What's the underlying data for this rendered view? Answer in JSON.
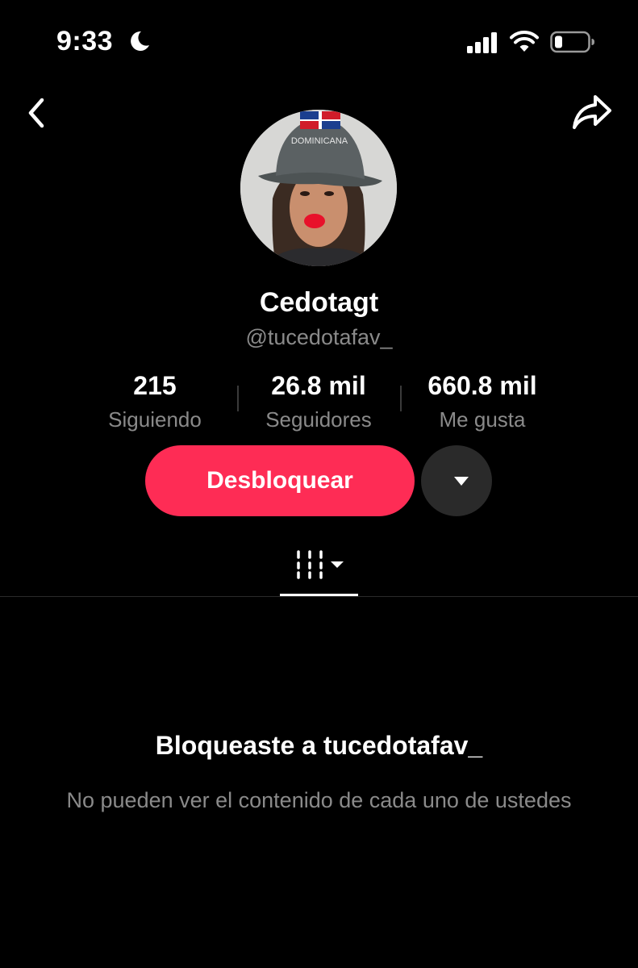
{
  "status_bar": {
    "time": "9:33",
    "icons": [
      "moon-icon",
      "signal-icon",
      "wifi-icon",
      "battery-icon"
    ]
  },
  "nav": {
    "icons": [
      "back-icon",
      "share-icon"
    ]
  },
  "profile": {
    "display_name": "Cedotagt",
    "username": "@tucedotafav_",
    "avatar_hat_text": "DOMINICANA"
  },
  "stats": [
    {
      "value": "215",
      "label": "Siguiendo"
    },
    {
      "value": "26.8 mil",
      "label": "Seguidores"
    },
    {
      "value": "660.8 mil",
      "label": "Me gusta"
    }
  ],
  "actions": {
    "unblock_label": "Desbloquear"
  },
  "tabs": {
    "icon": "grid-icon"
  },
  "blocked": {
    "title": "Bloqueaste a tucedotafav_",
    "description": "No pueden ver el contenido de cada uno de ustedes"
  },
  "colors": {
    "background": "#000000",
    "accent": "#fe2c55",
    "secondary_text": "#8a8a8a"
  }
}
